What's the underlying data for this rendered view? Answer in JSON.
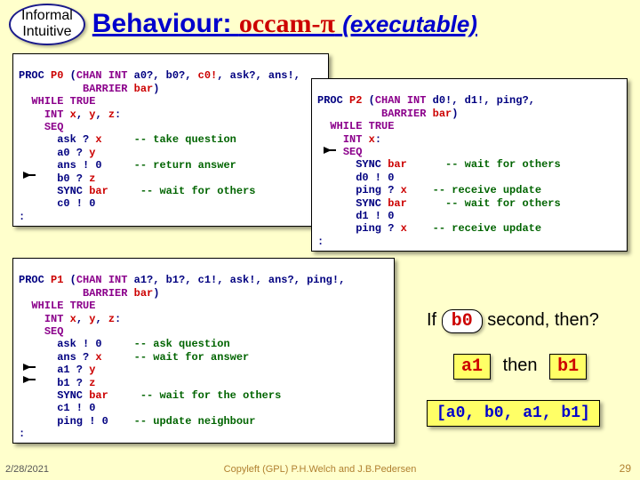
{
  "header": {
    "oval_line1": "Informal",
    "oval_line2": "Intuitive",
    "title_a": "Behaviour:",
    "title_b": "occam-π",
    "title_c": "(executable)"
  },
  "p0": {
    "l1a": "PROC ",
    "l1_name": "P0",
    "l1b": " (",
    "l1c": "CHAN INT",
    "l1d": " a0?, b0?, ",
    "l1e": "c0!",
    "l1f": ", ask?, ans!,",
    "l2a": "          ",
    "l2b": "BARRIER",
    "l2c": " ",
    "l2d": "bar",
    "l2e": ")",
    "l3a": "  ",
    "l3b": "WHILE TRUE",
    "l4a": "    ",
    "l4b": "INT",
    "l4c": " ",
    "l4d": "x",
    "l4e": ", ",
    "l4f": "y",
    "l4g": ", ",
    "l4h": "z",
    "l4i": ":",
    "l5a": "    ",
    "l5b": "SEQ",
    "l6a": "      ask ? ",
    "l6b": "x",
    "l6c": "     ",
    "l6d": "-- take question",
    "l7a": "      a0 ? ",
    "l7b": "y",
    "l8a": "      ans ! 0",
    "l8b": "     ",
    "l8c": "-- return answer",
    "l9a": "      b0 ? ",
    "l9b": "z",
    "l10a": "      SYNC ",
    "l10b": "bar",
    "l10c": "     ",
    "l10d": "-- wait for others",
    "l11a": "      c0 ! 0",
    "l12": ":"
  },
  "p2": {
    "l1a": "PROC ",
    "l1_name": "P2",
    "l1b": " (",
    "l1c": "CHAN INT",
    "l1d": " d0!, d1!, ping?,",
    "l2a": "          ",
    "l2b": "BARRIER",
    "l2c": " ",
    "l2d": "bar",
    "l2e": ")",
    "l3a": "  ",
    "l3b": "WHILE TRUE",
    "l4a": "    ",
    "l4b": "INT",
    "l4c": " ",
    "l4d": "x",
    "l4e": ":",
    "l5a": "    ",
    "l5b": "SEQ",
    "l6a": "      SYNC ",
    "l6b": "bar",
    "l6c": "      ",
    "l6d": "-- wait for others",
    "l7a": "      d0 ! 0",
    "l8a": "      ping ? ",
    "l8b": "x",
    "l8c": "    ",
    "l8d": "-- receive update",
    "l9a": "      SYNC ",
    "l9b": "bar",
    "l9c": "      ",
    "l9d": "-- wait for others",
    "l10a": "      d1 ! 0",
    "l11a": "      ping ? ",
    "l11b": "x",
    "l11c": "    ",
    "l11d": "-- receive update",
    "l12": ":"
  },
  "p1": {
    "l1a": "PROC ",
    "l1_name": "P1",
    "l1b": " (",
    "l1c": "CHAN INT",
    "l1d": " a1?, b1?, c1!, ask!, ans?, ping!,",
    "l2a": "          ",
    "l2b": "BARRIER",
    "l2c": " ",
    "l2d": "bar",
    "l2e": ")",
    "l3a": "  ",
    "l3b": "WHILE TRUE",
    "l4a": "    ",
    "l4b": "INT",
    "l4c": " ",
    "l4d": "x",
    "l4e": ", ",
    "l4f": "y",
    "l4g": ", ",
    "l4h": "z",
    "l4i": ":",
    "l5a": "    ",
    "l5b": "SEQ",
    "l6a": "      ask ! 0",
    "l6b": "     ",
    "l6c": "-- ask question",
    "l7a": "      ans ? ",
    "l7b": "x",
    "l7c": "     ",
    "l7d": "-- wait for answer",
    "l8a": "      a1 ? ",
    "l8b": "y",
    "l9a": "      b1 ? ",
    "l9b": "z",
    "l10a": "      SYNC ",
    "l10b": "bar",
    "l10c": "     ",
    "l10d": "-- wait for the others",
    "l11a": "      c1 ! 0",
    "l12a": "      ping ! 0",
    "l12b": "    ",
    "l12c": "-- update neighbour",
    "l13": ":"
  },
  "q": {
    "if": "If",
    "b0": "b0",
    "second": "second, then?",
    "a1": "a1",
    "then": "then",
    "b1": "b1",
    "answer": "[a0, b0, a1, b1]"
  },
  "footer": {
    "date": "2/28/2021",
    "center": "Copyleft (GPL) P.H.Welch and J.B.Pedersen",
    "page": "29"
  }
}
